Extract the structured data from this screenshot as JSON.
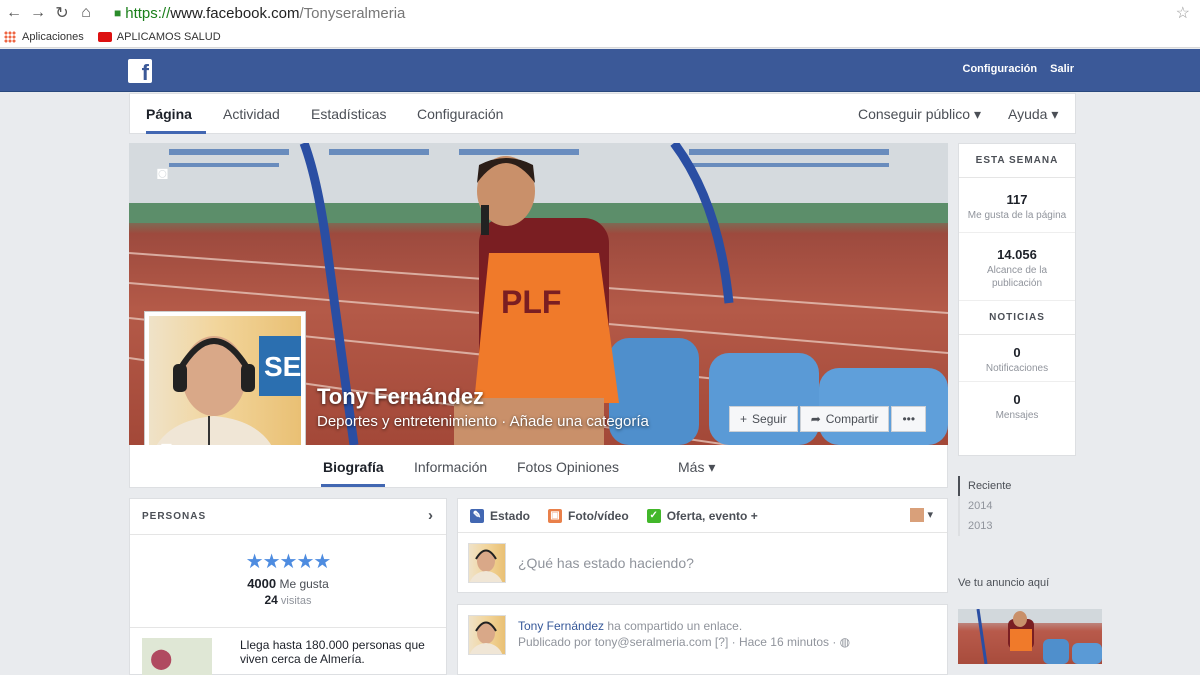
{
  "browser": {
    "url_https": "https://",
    "url_host": "www.facebook.com",
    "url_path": "/Tonyseralmeria",
    "bookmarks": [
      {
        "label": "Aplicaciones"
      },
      {
        "label": "APLICAMOS SALUD"
      }
    ]
  },
  "topbar": {
    "logo": "f",
    "links": [
      "Configuración",
      "Salir"
    ]
  },
  "page_nav": {
    "items": [
      "Página",
      "Actividad",
      "Estadísticas",
      "Configuración"
    ],
    "right_items": [
      "Conseguir público ▾",
      "Ayuda ▾"
    ]
  },
  "cover": {
    "name": "Tony Fernández",
    "category": "Deportes y entretenimiento · Añade una categoría",
    "buttons": [
      {
        "icon": "+",
        "label": "Seguir"
      },
      {
        "icon": "➦",
        "label": "Compartir"
      },
      {
        "icon": "•••",
        "label": ""
      }
    ],
    "vest_text": "PLF",
    "logo_text": "SE"
  },
  "timeline_nav": {
    "items": [
      "Biografía",
      "Información",
      "Fotos",
      "Opiniones",
      "Más ▾"
    ]
  },
  "week": {
    "header": "ESTA SEMANA",
    "stats": [
      {
        "value": "117",
        "label": "Me gusta de la página"
      },
      {
        "value": "14.056",
        "label": "Alcance de la publicación"
      }
    ],
    "news_header": "NOTICIAS",
    "news": [
      {
        "value": "0",
        "label": "Notificaciones"
      },
      {
        "value": "0",
        "label": "Mensajes"
      }
    ]
  },
  "years": [
    "Reciente",
    "2014",
    "2013"
  ],
  "ad": {
    "label": "Ve tu anuncio aquí"
  },
  "people": {
    "header": "PERSONAS",
    "stars": "★★★★★",
    "likes_value": "4000",
    "likes_label": "Me gusta",
    "visits_value": "24",
    "visits_label": "visitas",
    "reach_text": "Llega hasta 180.000 personas que viven cerca de Almería."
  },
  "composer": {
    "tabs": [
      {
        "label": "Estado",
        "color": "#4267b2"
      },
      {
        "label": "Foto/vídeo",
        "color": "#e9804a"
      },
      {
        "label": "Oferta, evento +",
        "color": "#42b72a"
      }
    ],
    "placeholder": "¿Qué has estado haciendo?"
  },
  "post": {
    "author": "Tony Fernández",
    "action": "ha compartido un enlace.",
    "meta": "Publicado por tony@seralmeria.com [?] · Hace 16 minutos · ◍"
  }
}
